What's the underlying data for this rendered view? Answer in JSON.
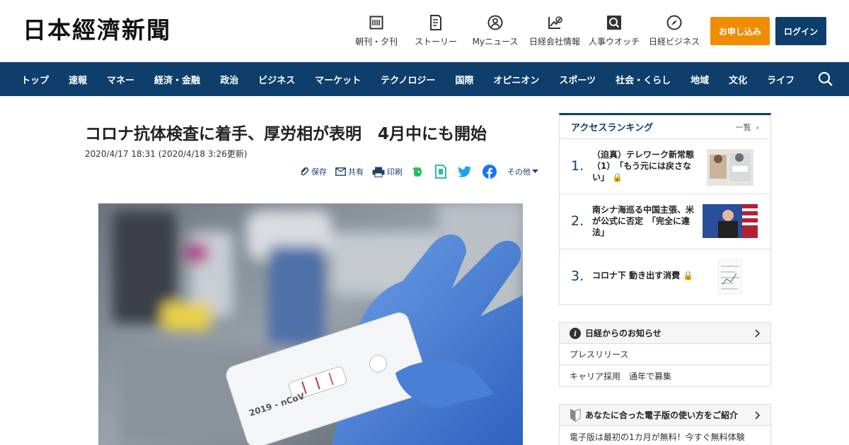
{
  "header": {
    "logo": "日本經濟新聞",
    "nav": [
      {
        "label": "朝刊・夕刊",
        "icon": "newspaper-icon"
      },
      {
        "label": "ストーリー",
        "icon": "story-icon"
      },
      {
        "label": "Myニュース",
        "icon": "person-icon"
      },
      {
        "label": "日経会社情報",
        "icon": "chart-icon"
      },
      {
        "label": "人事ウオッチ",
        "icon": "search-person-icon"
      },
      {
        "label": "日経ビジネス",
        "icon": "compass-icon"
      }
    ],
    "apply_label": "お申し込み",
    "login_label": "ログイン"
  },
  "navbar": {
    "items": [
      "トップ",
      "速報",
      "マネー",
      "経済・金融",
      "政治",
      "ビジネス",
      "マーケット",
      "テクノロジー",
      "国際",
      "オピニオン",
      "スポーツ",
      "社会・くらし",
      "地域",
      "文化",
      "ライフ"
    ]
  },
  "article": {
    "title": "コロナ抗体検査に着手、厚労相が表明　4月中にも開始",
    "date": "2020/4/17 18:31 (2020/4/18 3:26更新)",
    "share": {
      "save": "保存",
      "share": "共有",
      "print": "印刷",
      "other": "その他"
    },
    "photo_text": "2019 - nCoV"
  },
  "ranking": {
    "title": "アクセスランキング",
    "more": "一覧",
    "items": [
      {
        "rank": "1.",
        "text": "（迫真）テレワーク新常態（1）　「もう元には戻さない」"
      },
      {
        "rank": "2.",
        "text": "南シナ海巡る中国主張、米が公式に否定　「完全に違法」"
      },
      {
        "rank": "3.",
        "text": "コロナ下 動き出す消費"
      }
    ]
  },
  "notice": {
    "title": "日経からのお知らせ",
    "rows": [
      "プレスリリース",
      "キャリア採用　通年で募集"
    ]
  },
  "guide": {
    "title": "あなたに合った電子版の使い方をご紹介",
    "row": "電子版は最初の1カ月が無料！今すぐ無料体験"
  },
  "colors": {
    "brand_navy": "#0e3e6b",
    "apply_orange": "#f08c00",
    "evernote_green": "#2dbe60",
    "twitter_blue": "#1da1f2",
    "facebook_blue": "#1877f2"
  }
}
